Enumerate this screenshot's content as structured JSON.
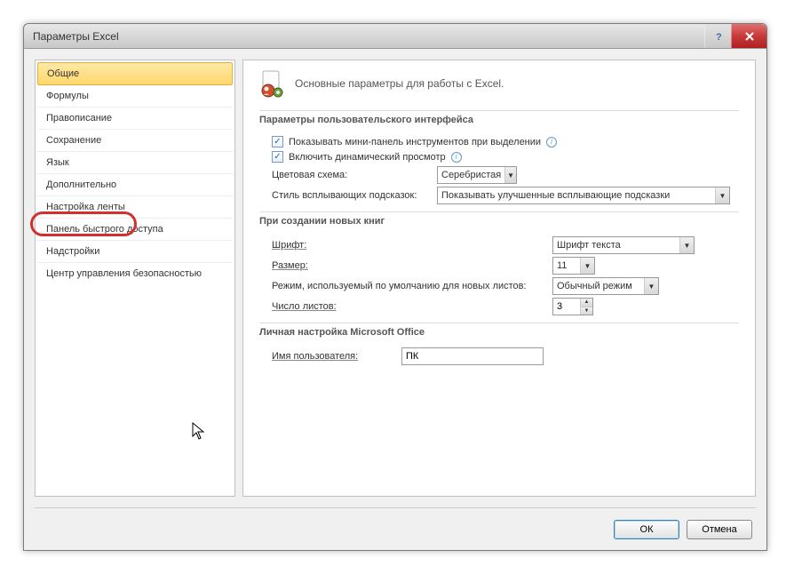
{
  "window": {
    "title": "Параметры Excel"
  },
  "sidebar": {
    "items": [
      "Общие",
      "Формулы",
      "Правописание",
      "Сохранение",
      "Язык",
      "Дополнительно",
      "Настройка ленты",
      "Панель быстрого доступа",
      "Надстройки",
      "Центр управления безопасностью"
    ]
  },
  "main": {
    "heading": "Основные параметры для работы с Excel.",
    "section1": {
      "title": "Параметры пользовательского интерфейса",
      "cb1": "Показывать мини-панель инструментов при выделении",
      "cb2": "Включить динамический просмотр",
      "color_scheme_label": "Цветовая схема:",
      "color_scheme_value": "Серебристая",
      "tooltip_label": "Стиль всплывающих подсказок:",
      "tooltip_value": "Показывать улучшенные всплывающие подсказки"
    },
    "section2": {
      "title": "При создании новых книг",
      "font_label": "Шрифт:",
      "font_value": "Шрифт текста",
      "size_label": "Размер:",
      "size_value": "11",
      "mode_label": "Режим, используемый по умолчанию для новых листов:",
      "mode_value": "Обычный режим",
      "sheets_label": "Число листов:",
      "sheets_value": "3"
    },
    "section3": {
      "title": "Личная настройка Microsoft Office",
      "username_label": "Имя пользователя:",
      "username_value": "ПК"
    }
  },
  "footer": {
    "ok": "ОК",
    "cancel": "Отмена"
  }
}
